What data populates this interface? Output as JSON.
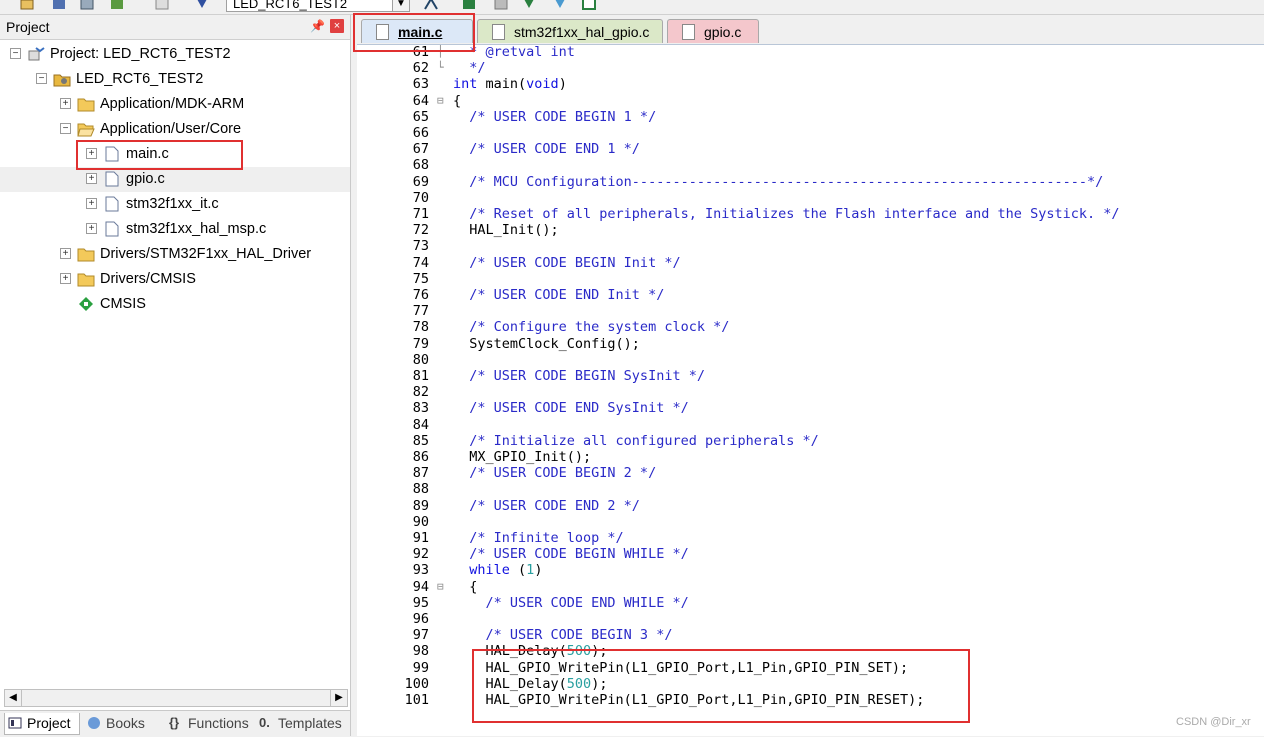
{
  "toolbar": {
    "target_combo": "LED_RCT6_TEST2",
    "icons": [
      "open-icon",
      "save-icon",
      "layout-icon",
      "book-icon",
      "find-icon",
      "download-icon",
      "options-icon",
      "build-icon",
      "rebuild-icon",
      "insert-icon",
      "debug-icon"
    ]
  },
  "project_panel": {
    "title": "Project",
    "tree": [
      {
        "label": "Project: LED_RCT6_TEST2",
        "icon": "project-root-icon",
        "expander": "−"
      },
      {
        "label": "LED_RCT6_TEST2",
        "icon": "target-icon",
        "expander": "−"
      },
      {
        "label": "Application/MDK-ARM",
        "icon": "folder-icon",
        "expander": "+"
      },
      {
        "label": "Application/User/Core",
        "icon": "folder-open-icon",
        "expander": "−"
      },
      {
        "label": "main.c",
        "icon": "file-icon",
        "expander": "+"
      },
      {
        "label": "gpio.c",
        "icon": "file-icon",
        "expander": "+"
      },
      {
        "label": "stm32f1xx_it.c",
        "icon": "file-icon",
        "expander": "+"
      },
      {
        "label": "stm32f1xx_hal_msp.c",
        "icon": "file-icon",
        "expander": "+"
      },
      {
        "label": "Drivers/STM32F1xx_HAL_Driver",
        "icon": "folder-icon",
        "expander": "+"
      },
      {
        "label": "Drivers/CMSIS",
        "icon": "folder-icon",
        "expander": "+"
      },
      {
        "label": "CMSIS",
        "icon": "cmsis-diamond-icon",
        "expander": ""
      }
    ],
    "bottom_tabs": [
      "Project",
      "Books",
      "Functions",
      "Templates"
    ]
  },
  "editor": {
    "tabs": [
      "main.c",
      "stm32f1xx_hal_gpio.c",
      "gpio.c"
    ],
    "lines": [
      {
        "n": "61",
        "fold": "│",
        "t": "  * @retval int",
        "c": "cm"
      },
      {
        "n": "62",
        "fold": "└",
        "t": "  */",
        "c": "cm"
      },
      {
        "n": "63",
        "fold": "",
        "t": "int main(void)",
        "c": "mix_int"
      },
      {
        "n": "64",
        "fold": "⊟",
        "t": "{",
        "c": ""
      },
      {
        "n": "65",
        "fold": "",
        "t": "  /* USER CODE BEGIN 1 */",
        "c": "cm"
      },
      {
        "n": "66",
        "fold": "",
        "t": "",
        "c": ""
      },
      {
        "n": "67",
        "fold": "",
        "t": "  /* USER CODE END 1 */",
        "c": "cm"
      },
      {
        "n": "68",
        "fold": "",
        "t": "",
        "c": ""
      },
      {
        "n": "69",
        "fold": "",
        "t": "  /* MCU Configuration--------------------------------------------------------*/",
        "c": "cm"
      },
      {
        "n": "70",
        "fold": "",
        "t": "",
        "c": ""
      },
      {
        "n": "71",
        "fold": "",
        "t": "  /* Reset of all peripherals, Initializes the Flash interface and the Systick. */",
        "c": "cm"
      },
      {
        "n": "72",
        "fold": "",
        "t": "  HAL_Init();",
        "c": ""
      },
      {
        "n": "73",
        "fold": "",
        "t": "",
        "c": ""
      },
      {
        "n": "74",
        "fold": "",
        "t": "  /* USER CODE BEGIN Init */",
        "c": "cm"
      },
      {
        "n": "75",
        "fold": "",
        "t": "",
        "c": ""
      },
      {
        "n": "76",
        "fold": "",
        "t": "  /* USER CODE END Init */",
        "c": "cm"
      },
      {
        "n": "77",
        "fold": "",
        "t": "",
        "c": ""
      },
      {
        "n": "78",
        "fold": "",
        "t": "  /* Configure the system clock */",
        "c": "cm"
      },
      {
        "n": "79",
        "fold": "",
        "t": "  SystemClock_Config();",
        "c": ""
      },
      {
        "n": "80",
        "fold": "",
        "t": "",
        "c": ""
      },
      {
        "n": "81",
        "fold": "",
        "t": "  /* USER CODE BEGIN SysInit */",
        "c": "cm"
      },
      {
        "n": "82",
        "fold": "",
        "t": "",
        "c": ""
      },
      {
        "n": "83",
        "fold": "",
        "t": "  /* USER CODE END SysInit */",
        "c": "cm"
      },
      {
        "n": "84",
        "fold": "",
        "t": "",
        "c": ""
      },
      {
        "n": "85",
        "fold": "",
        "t": "  /* Initialize all configured peripherals */",
        "c": "cm"
      },
      {
        "n": "86",
        "fold": "",
        "t": "  MX_GPIO_Init();",
        "c": ""
      },
      {
        "n": "87",
        "fold": "",
        "t": "  /* USER CODE BEGIN 2 */",
        "c": "cm"
      },
      {
        "n": "88",
        "fold": "",
        "t": "",
        "c": ""
      },
      {
        "n": "89",
        "fold": "",
        "t": "  /* USER CODE END 2 */",
        "c": "cm"
      },
      {
        "n": "90",
        "fold": "",
        "t": "",
        "c": ""
      },
      {
        "n": "91",
        "fold": "",
        "t": "  /* Infinite loop */",
        "c": "cm"
      },
      {
        "n": "92",
        "fold": "",
        "t": "  /* USER CODE BEGIN WHILE */",
        "c": "cm"
      },
      {
        "n": "93",
        "fold": "",
        "t": "  while (1)",
        "c": "mix_while"
      },
      {
        "n": "94",
        "fold": "⊟",
        "t": "  {",
        "c": ""
      },
      {
        "n": "95",
        "fold": "",
        "t": "    /* USER CODE END WHILE */",
        "c": "cm"
      },
      {
        "n": "96",
        "fold": "",
        "t": "",
        "c": ""
      },
      {
        "n": "97",
        "fold": "",
        "t": "    /* USER CODE BEGIN 3 */",
        "c": "cm"
      },
      {
        "n": "98",
        "fold": "",
        "t": "    HAL_Delay(500);",
        "c": "mix_delay"
      },
      {
        "n": "99",
        "fold": "",
        "t": "    HAL_GPIO_WritePin(L1_GPIO_Port,L1_Pin,GPIO_PIN_SET);",
        "c": ""
      },
      {
        "n": "100",
        "fold": "",
        "t": "    HAL_Delay(500);",
        "c": "mix_delay"
      },
      {
        "n": "101",
        "fold": "",
        "t": "    HAL_GPIO_WritePin(L1_GPIO_Port,L1_Pin,GPIO_PIN_RESET);",
        "c": ""
      }
    ]
  },
  "watermark": "CSDN @Dir_xr",
  "colors": {
    "highlight_box": "#e03030",
    "comment": "#2a2ac8",
    "keyword": "#1010e0",
    "number": "#2aa0a0"
  }
}
